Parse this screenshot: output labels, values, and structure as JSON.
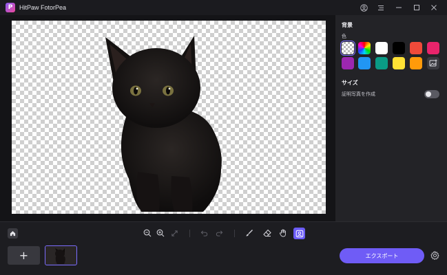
{
  "window": {
    "title": "HitPaw FotorPea",
    "logo_letter": "P",
    "controls": [
      "account",
      "menu",
      "minimize",
      "maximize",
      "close"
    ]
  },
  "panel": {
    "background_title": "背景",
    "color_label": "色",
    "swatches": [
      {
        "name": "transparent",
        "color": "transparent",
        "selected": true
      },
      {
        "name": "rainbow",
        "color": "gradient"
      },
      {
        "name": "white",
        "color": "#ffffff"
      },
      {
        "name": "black",
        "color": "#000000"
      },
      {
        "name": "red",
        "color": "#f04a3a"
      },
      {
        "name": "pink",
        "color": "#e8246b"
      },
      {
        "name": "purple",
        "color": "#9c27b0"
      },
      {
        "name": "blue",
        "color": "#2196f3"
      },
      {
        "name": "teal",
        "color": "#0a9b86"
      },
      {
        "name": "yellow",
        "color": "#ffe135"
      },
      {
        "name": "orange",
        "color": "#ff9a0a"
      },
      {
        "name": "custom-image",
        "color": "icon"
      }
    ],
    "size_title": "サイズ",
    "id_photo_label": "証明写真を作成",
    "id_photo_enabled": false
  },
  "toolbar": {
    "tools": [
      "home",
      "zoom-out",
      "zoom-in",
      "fit",
      "undo",
      "redo",
      "brush",
      "eraser",
      "hand",
      "compare"
    ],
    "active_tool": "compare"
  },
  "bottom": {
    "add_label": "+",
    "export_label": "エクスポート"
  },
  "colors": {
    "accent": "#6f5cf6",
    "panel_bg": "#232327",
    "app_bg": "#1a1a1e"
  }
}
